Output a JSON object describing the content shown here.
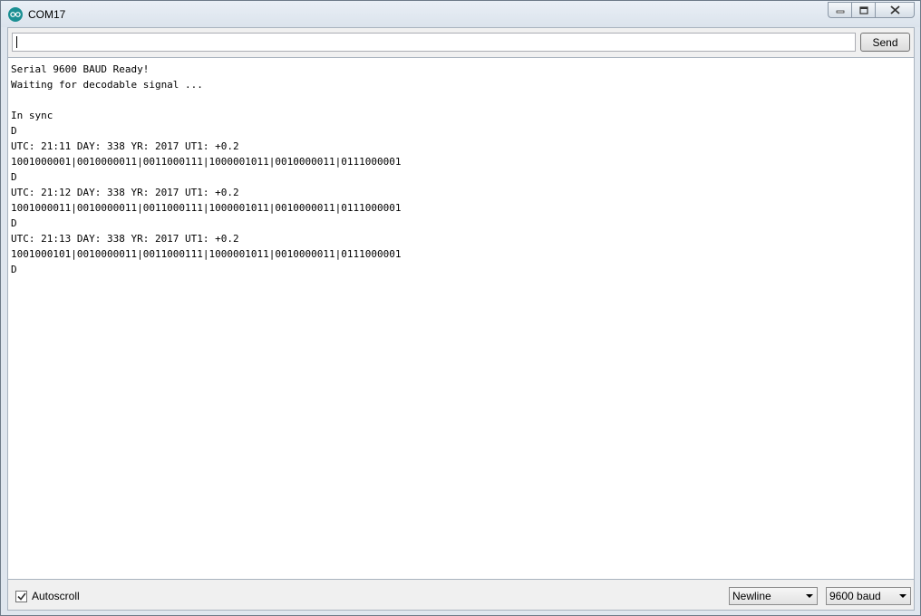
{
  "window": {
    "title": "COM17"
  },
  "toolbar": {
    "send_label": "Send",
    "input_value": ""
  },
  "output": {
    "lines": [
      "Serial 9600 BAUD Ready!",
      "Waiting for decodable signal ...",
      "",
      "In sync",
      "D",
      "UTC: 21:11 DAY: 338 YR: 2017 UT1: +0.2",
      "1001000001|0010000011|0011000111|1000001011|0010000011|0111000001",
      "D",
      "UTC: 21:12 DAY: 338 YR: 2017 UT1: +0.2",
      "1001000011|0010000011|0011000111|1000001011|0010000011|0111000001",
      "D",
      "UTC: 21:13 DAY: 338 YR: 2017 UT1: +0.2",
      "1001000101|0010000011|0011000111|1000001011|0010000011|0111000001",
      "D"
    ]
  },
  "footer": {
    "autoscroll_label": "Autoscroll",
    "autoscroll_checked": true,
    "line_ending": "Newline",
    "baud_rate": "9600 baud"
  },
  "icons": {
    "app": "arduino-icon",
    "minimize": "minimize-icon",
    "maximize": "maximize-icon",
    "close": "close-icon",
    "check": "checkmark-icon",
    "dropdown": "chevron-down-icon"
  }
}
